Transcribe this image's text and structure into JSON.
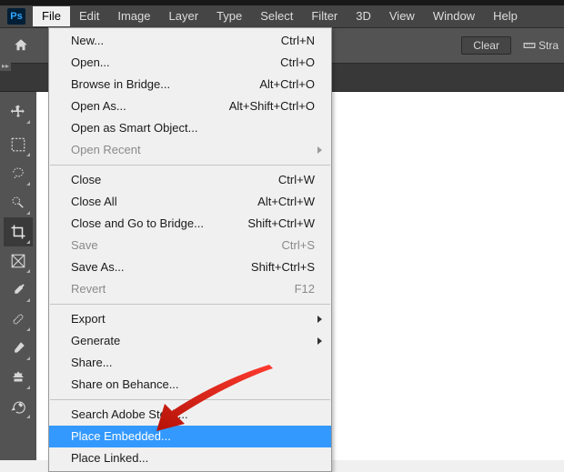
{
  "app_icon": "Ps",
  "menus": [
    "File",
    "Edit",
    "Image",
    "Layer",
    "Type",
    "Select",
    "Filter",
    "3D",
    "View",
    "Window",
    "Help"
  ],
  "optionsbar": {
    "clear": "Clear",
    "stra": "Stra"
  },
  "file_menu": {
    "g1": [
      {
        "label": "New...",
        "shortcut": "Ctrl+N"
      },
      {
        "label": "Open...",
        "shortcut": "Ctrl+O"
      },
      {
        "label": "Browse in Bridge...",
        "shortcut": "Alt+Ctrl+O"
      },
      {
        "label": "Open As...",
        "shortcut": "Alt+Shift+Ctrl+O"
      },
      {
        "label": "Open as Smart Object..."
      },
      {
        "label": "Open Recent",
        "submenu": true,
        "disabled": true
      }
    ],
    "g2": [
      {
        "label": "Close",
        "shortcut": "Ctrl+W"
      },
      {
        "label": "Close All",
        "shortcut": "Alt+Ctrl+W"
      },
      {
        "label": "Close and Go to Bridge...",
        "shortcut": "Shift+Ctrl+W"
      },
      {
        "label": "Save",
        "shortcut": "Ctrl+S",
        "disabled": true
      },
      {
        "label": "Save As...",
        "shortcut": "Shift+Ctrl+S"
      },
      {
        "label": "Revert",
        "shortcut": "F12",
        "disabled": true
      }
    ],
    "g3": [
      {
        "label": "Export",
        "submenu": true
      },
      {
        "label": "Generate",
        "submenu": true
      },
      {
        "label": "Share..."
      },
      {
        "label": "Share on Behance..."
      }
    ],
    "g4": [
      {
        "label": "Search Adobe Stock..."
      },
      {
        "label": "Place Embedded...",
        "highlight": true
      },
      {
        "label": "Place Linked..."
      }
    ]
  }
}
